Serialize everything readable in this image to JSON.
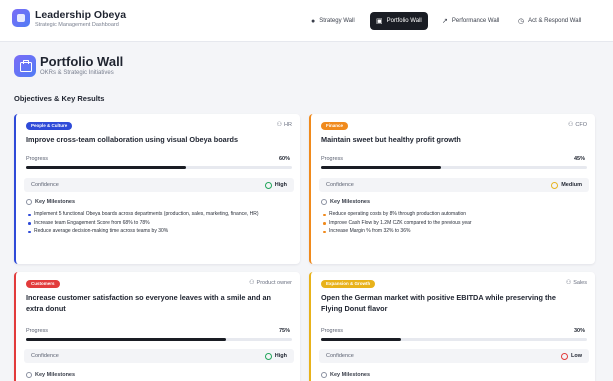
{
  "brand": {
    "title": "Leadership Obeya",
    "subtitle": "Strategic Management Dashboard"
  },
  "nav": [
    {
      "label": "Strategy Wall",
      "icon": "circle-icon",
      "active": false
    },
    {
      "label": "Portfolio Wall",
      "icon": "briefcase-icon",
      "active": true
    },
    {
      "label": "Performance Wall",
      "icon": "trend-icon",
      "active": false
    },
    {
      "label": "Act & Respond Wall",
      "icon": "clock-icon",
      "active": false
    }
  ],
  "page": {
    "title": "Portfolio Wall",
    "subtitle": "OKRs & Strategic Initiatives",
    "section_title": "Objectives & Key Results"
  },
  "labels": {
    "progress": "Progress",
    "confidence": "Confidence",
    "milestones": "Key Milestones"
  },
  "cards": [
    {
      "category": "People & Culture",
      "category_color": "#2f4bd8",
      "border_color": "#2f4bd8",
      "owner": "HR",
      "objective": "Improve cross-team collaboration using visual Obeya boards",
      "progress": 60,
      "progress_text": "60%",
      "confidence": "High",
      "confidence_color": "#22a55b",
      "milestones": [
        "Implement 5 functional Obeya boards across departments (production, sales, marketing, finance, HR)",
        "Increase team Engagement Score from 68% to 78%",
        "Reduce average decision-making time across teams by 30%"
      ]
    },
    {
      "category": "Finance",
      "category_color": "#f08a1c",
      "border_color": "#f08a1c",
      "owner": "CFO",
      "objective": "Maintain sweet but healthy profit growth",
      "progress": 45,
      "progress_text": "45%",
      "confidence": "Medium",
      "confidence_color": "#e6b422",
      "milestones": [
        "Reduce operating costs by 8% through production automation",
        "Improve Cash Flow by 1.2M CZK compared to the previous year",
        "Increase Margin % from 32% to 36%"
      ]
    },
    {
      "category": "Customers",
      "category_color": "#e23b3b",
      "border_color": "#e23b3b",
      "owner": "Product owner",
      "objective": "Increase customer satisfaction so everyone leaves with a smile and an extra donut",
      "progress": 75,
      "progress_text": "75%",
      "confidence": "High",
      "confidence_color": "#22a55b",
      "milestones": []
    },
    {
      "category": "Expansion & Growth",
      "category_color": "#e8b21a",
      "border_color": "#e8b21a",
      "owner": "Sales",
      "objective": "Open the German market with positive EBITDA while preserving the Flying Donut flavor",
      "progress": 30,
      "progress_text": "30%",
      "confidence": "Low",
      "confidence_color": "#e23b3b",
      "milestones": []
    }
  ]
}
